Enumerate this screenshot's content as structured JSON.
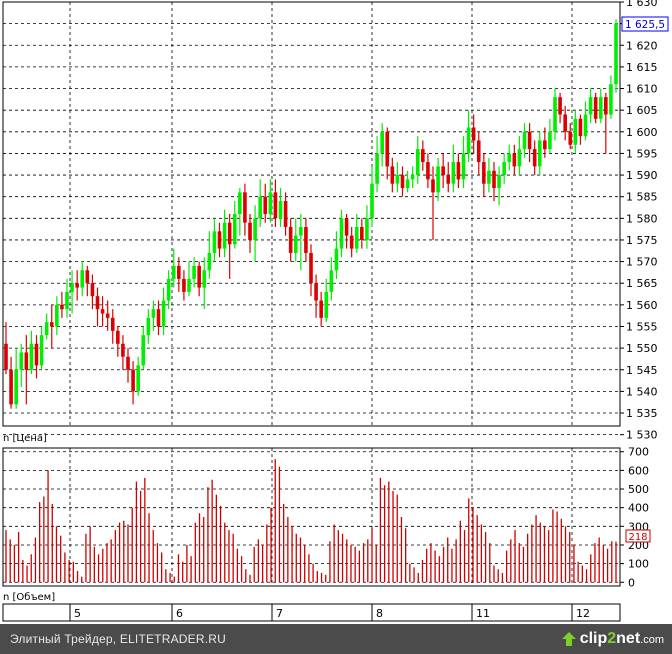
{
  "chart_data": [
    {
      "type": "candlestick",
      "ylim": [
        1532,
        1630
      ],
      "yticks": [
        "1 630",
        "1 625",
        "1 620",
        "1 615",
        "1 610",
        "1 605",
        "1 600",
        "1 595",
        "1 590",
        "1 585",
        "1 580",
        "1 575",
        "1 570",
        "1 565",
        "1 560",
        "1 555",
        "1 550",
        "1 545",
        "1 540",
        "1 535",
        "1 530"
      ],
      "last_price_label": "1 625,5",
      "panel_label": "n [Цена]",
      "colors": {
        "up": "#00ee00",
        "down": "#dd0000"
      },
      "candles": [
        [
          1551,
          1545,
          1556,
          1544
        ],
        [
          1545,
          1537,
          1548,
          1536
        ],
        [
          1537,
          1545,
          1550,
          1536
        ],
        [
          1545,
          1549,
          1551,
          1541
        ],
        [
          1549,
          1545,
          1553,
          1537
        ],
        [
          1545,
          1551,
          1554,
          1544
        ],
        [
          1551,
          1546,
          1553,
          1543
        ],
        [
          1546,
          1553,
          1555,
          1545
        ],
        [
          1553,
          1556,
          1558,
          1552
        ],
        [
          1556,
          1555,
          1560,
          1550
        ],
        [
          1555,
          1560,
          1562,
          1553
        ],
        [
          1560,
          1559,
          1563,
          1557
        ],
        [
          1559,
          1563,
          1566,
          1557
        ],
        [
          1563,
          1565,
          1568,
          1558
        ],
        [
          1565,
          1564,
          1568,
          1561
        ],
        [
          1564,
          1568,
          1570,
          1562
        ],
        [
          1568,
          1565,
          1569,
          1562
        ],
        [
          1565,
          1562,
          1567,
          1559
        ],
        [
          1562,
          1559,
          1564,
          1555
        ],
        [
          1559,
          1558,
          1562,
          1555
        ],
        [
          1558,
          1557,
          1561,
          1554
        ],
        [
          1557,
          1554,
          1559,
          1551
        ],
        [
          1554,
          1551,
          1555,
          1548
        ],
        [
          1551,
          1548,
          1553,
          1545
        ],
        [
          1548,
          1545,
          1550,
          1542
        ],
        [
          1545,
          1540,
          1547,
          1537
        ],
        [
          1540,
          1546,
          1548,
          1539
        ],
        [
          1546,
          1553,
          1555,
          1545
        ],
        [
          1553,
          1557,
          1559,
          1551
        ],
        [
          1557,
          1559,
          1561,
          1554
        ],
        [
          1559,
          1555,
          1561,
          1553
        ],
        [
          1555,
          1561,
          1564,
          1553
        ],
        [
          1561,
          1566,
          1568,
          1559
        ],
        [
          1566,
          1569,
          1573,
          1564
        ],
        [
          1569,
          1566,
          1571,
          1563
        ],
        [
          1566,
          1563,
          1568,
          1561
        ],
        [
          1563,
          1566,
          1570,
          1562
        ],
        [
          1566,
          1569,
          1571,
          1564
        ],
        [
          1569,
          1564,
          1570,
          1562
        ],
        [
          1564,
          1568,
          1571,
          1559
        ],
        [
          1568,
          1572,
          1577,
          1566
        ],
        [
          1572,
          1577,
          1580,
          1570
        ],
        [
          1577,
          1573,
          1579,
          1571
        ],
        [
          1573,
          1579,
          1582,
          1571
        ],
        [
          1579,
          1574,
          1581,
          1566
        ],
        [
          1574,
          1581,
          1584,
          1573
        ],
        [
          1581,
          1586,
          1587,
          1576
        ],
        [
          1586,
          1579,
          1588,
          1576
        ],
        [
          1579,
          1575,
          1581,
          1572
        ],
        [
          1575,
          1580,
          1583,
          1570
        ],
        [
          1580,
          1585,
          1589,
          1578
        ],
        [
          1585,
          1581,
          1588,
          1579
        ],
        [
          1581,
          1586,
          1589,
          1579
        ],
        [
          1586,
          1580,
          1589,
          1578
        ],
        [
          1580,
          1584,
          1587,
          1578
        ],
        [
          1584,
          1578,
          1586,
          1576
        ],
        [
          1578,
          1572,
          1580,
          1570
        ],
        [
          1572,
          1576,
          1580,
          1570
        ],
        [
          1576,
          1578,
          1581,
          1568
        ],
        [
          1578,
          1572,
          1580,
          1570
        ],
        [
          1572,
          1565,
          1574,
          1562
        ],
        [
          1565,
          1561,
          1567,
          1557
        ],
        [
          1561,
          1557,
          1563,
          1555
        ],
        [
          1557,
          1563,
          1566,
          1556
        ],
        [
          1563,
          1568,
          1571,
          1561
        ],
        [
          1568,
          1573,
          1577,
          1566
        ],
        [
          1573,
          1580,
          1582,
          1571
        ],
        [
          1580,
          1576,
          1581,
          1573
        ],
        [
          1576,
          1573,
          1578,
          1571
        ],
        [
          1573,
          1578,
          1581,
          1572
        ],
        [
          1578,
          1575,
          1580,
          1573
        ],
        [
          1575,
          1580,
          1583,
          1573
        ],
        [
          1580,
          1588,
          1592,
          1578
        ],
        [
          1588,
          1595,
          1599,
          1586
        ],
        [
          1595,
          1600,
          1602,
          1592
        ],
        [
          1600,
          1592,
          1601,
          1589
        ],
        [
          1592,
          1588,
          1594,
          1586
        ],
        [
          1588,
          1590,
          1593,
          1586
        ],
        [
          1590,
          1587,
          1592,
          1585
        ],
        [
          1587,
          1589,
          1591,
          1586
        ],
        [
          1589,
          1590,
          1592,
          1587
        ],
        [
          1590,
          1596,
          1599,
          1588
        ],
        [
          1596,
          1593,
          1598,
          1591
        ],
        [
          1593,
          1589,
          1595,
          1587
        ],
        [
          1589,
          1586,
          1592,
          1575
        ],
        [
          1586,
          1592,
          1594,
          1584
        ],
        [
          1592,
          1590,
          1595,
          1587
        ],
        [
          1590,
          1588,
          1593,
          1586
        ],
        [
          1588,
          1593,
          1597,
          1586
        ],
        [
          1593,
          1589,
          1595,
          1587
        ],
        [
          1589,
          1595,
          1599,
          1587
        ],
        [
          1595,
          1601,
          1605,
          1593
        ],
        [
          1601,
          1598,
          1604,
          1595
        ],
        [
          1598,
          1593,
          1600,
          1590
        ],
        [
          1593,
          1588,
          1595,
          1585
        ],
        [
          1588,
          1591,
          1594,
          1586
        ],
        [
          1591,
          1587,
          1593,
          1584
        ],
        [
          1587,
          1590,
          1592,
          1583
        ],
        [
          1590,
          1593,
          1595,
          1588
        ],
        [
          1593,
          1595,
          1597,
          1591
        ],
        [
          1595,
          1592,
          1597,
          1590
        ],
        [
          1592,
          1596,
          1599,
          1590
        ],
        [
          1596,
          1600,
          1602,
          1594
        ],
        [
          1600,
          1596,
          1602,
          1593
        ],
        [
          1596,
          1592,
          1598,
          1590
        ],
        [
          1592,
          1598,
          1600,
          1590
        ],
        [
          1598,
          1596,
          1601,
          1594
        ],
        [
          1596,
          1600,
          1603,
          1595
        ],
        [
          1600,
          1608,
          1610,
          1598
        ],
        [
          1608,
          1604,
          1609,
          1602
        ],
        [
          1604,
          1600,
          1606,
          1598
        ],
        [
          1600,
          1597,
          1602,
          1596
        ],
        [
          1597,
          1603,
          1605,
          1595
        ],
        [
          1603,
          1599,
          1604,
          1597
        ],
        [
          1599,
          1604,
          1607,
          1598
        ],
        [
          1604,
          1608,
          1610,
          1602
        ],
        [
          1608,
          1603,
          1609,
          1602
        ],
        [
          1603,
          1608,
          1610,
          1602
        ],
        [
          1608,
          1604,
          1609,
          1595
        ],
        [
          1604,
          1611,
          1613,
          1603
        ],
        [
          1611,
          1625,
          1626,
          1609
        ]
      ]
    },
    {
      "type": "bar",
      "ylim": [
        -20,
        720
      ],
      "yticks": [
        "700",
        "600",
        "500",
        "400",
        "300",
        "200",
        "100",
        "0"
      ],
      "last_value_label": "218",
      "panel_label": "n [Объем]",
      "bar_color": "#cc0000",
      "values": [
        280,
        230,
        200,
        270,
        120,
        90,
        150,
        240,
        430,
        460,
        600,
        420,
        300,
        250,
        160,
        120,
        110,
        60,
        30,
        260,
        300,
        190,
        150,
        180,
        210,
        230,
        280,
        320,
        330,
        310,
        400,
        540,
        490,
        560,
        370,
        280,
        210,
        160,
        70,
        50,
        30,
        150,
        110,
        200,
        140,
        320,
        370,
        350,
        510,
        550,
        470,
        410,
        320,
        280,
        260,
        180,
        140,
        70,
        40,
        190,
        230,
        200,
        310,
        400,
        660,
        620,
        420,
        350,
        300,
        260,
        240,
        200,
        150,
        100,
        60,
        50,
        40,
        220,
        310,
        280,
        260,
        230,
        200,
        190,
        170,
        210,
        230,
        290,
        200,
        560,
        520,
        540,
        490,
        470,
        350,
        290,
        100,
        80,
        50,
        120,
        180,
        210,
        170,
        140,
        190,
        240,
        180,
        230,
        330,
        280,
        450,
        400,
        360,
        310,
        270,
        210,
        90,
        70,
        50,
        170,
        230,
        280,
        210,
        190,
        260,
        310,
        360,
        320,
        300,
        280,
        390,
        380,
        340,
        300,
        270,
        200,
        110,
        90,
        70,
        150,
        210,
        240,
        200,
        180,
        220,
        218
      ]
    }
  ],
  "x_axis": {
    "labels": [
      "5",
      "6",
      "7",
      "8",
      "11",
      "12"
    ]
  },
  "footer": {
    "text": "Элитный Трейдер, ELITETRADER.RU",
    "logo_clip": "clip",
    "logo_two": "2",
    "logo_net": "net",
    "logo_com": ".com"
  }
}
